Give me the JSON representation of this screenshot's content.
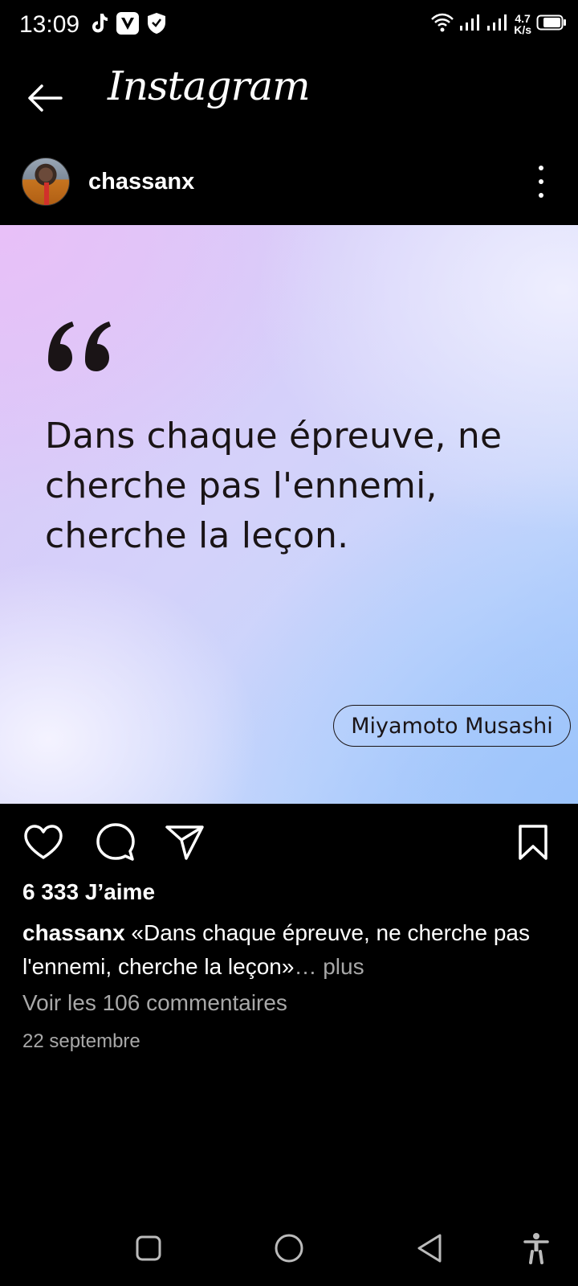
{
  "status_bar": {
    "time": "13:09",
    "net_speed_value": "4.7",
    "net_speed_unit": "K/s",
    "icons": [
      "tiktok-icon",
      "vpn-v-icon",
      "shield-icon",
      "wifi-icon",
      "signal-icon",
      "signal-icon",
      "battery-icon"
    ]
  },
  "header": {
    "title": "Instagram",
    "back_icon": "arrow-left-icon"
  },
  "post": {
    "username": "chassanx",
    "image": {
      "quote": "Dans chaque épreuve, ne cherche pas l'ennemi, cherche la leçon.",
      "author": "Miyamoto Musashi"
    },
    "likes": "6 333 J’aime",
    "caption_user": "chassanx",
    "caption_text": " «Dans chaque épreuve, ne cherche pas l'ennemi, cherche la leçon»",
    "caption_more": "… plus",
    "view_comments": "Voir les 106 commentaires",
    "date": "22 septembre"
  },
  "colors": {
    "background": "#000000",
    "text": "#ffffff",
    "muted": "#a8a8a8",
    "quote_text": "#1a1416"
  }
}
